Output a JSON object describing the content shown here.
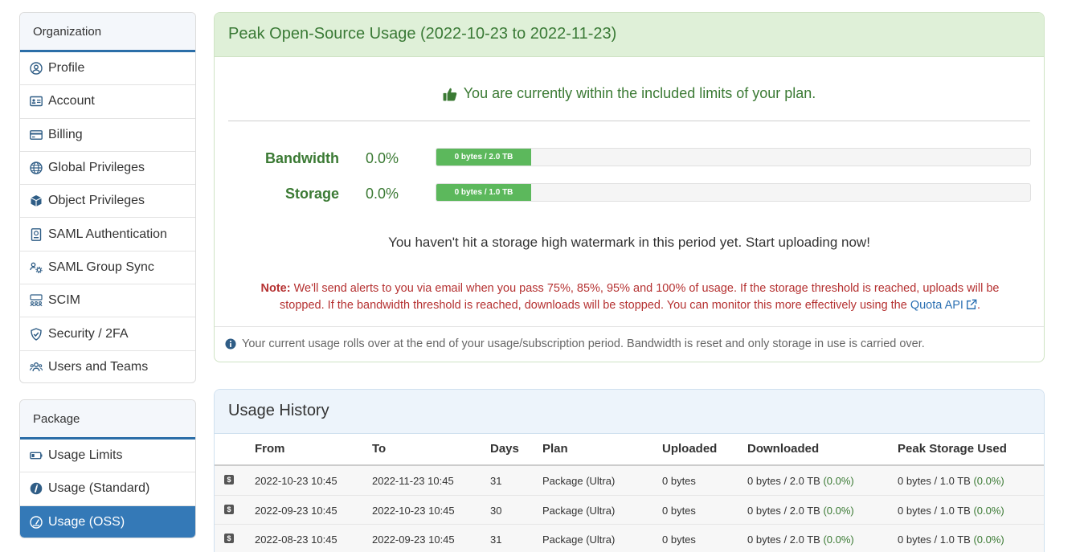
{
  "sidebar": {
    "organization": {
      "title": "Organization",
      "items": [
        {
          "label": "Profile",
          "icon": "user-circle-icon"
        },
        {
          "label": "Account",
          "icon": "id-card-icon"
        },
        {
          "label": "Billing",
          "icon": "credit-card-icon"
        },
        {
          "label": "Global Privileges",
          "icon": "globe-icon"
        },
        {
          "label": "Object Privileges",
          "icon": "cube-icon"
        },
        {
          "label": "SAML Authentication",
          "icon": "passport-icon"
        },
        {
          "label": "SAML Group Sync",
          "icon": "users-cog-icon"
        },
        {
          "label": "SCIM",
          "icon": "network-users-icon"
        },
        {
          "label": "Security / 2FA",
          "icon": "shield-check-icon"
        },
        {
          "label": "Users and Teams",
          "icon": "users-icon"
        }
      ]
    },
    "package": {
      "title": "Package",
      "items": [
        {
          "label": "Usage Limits",
          "icon": "battery-icon",
          "active": false
        },
        {
          "label": "Usage (Standard)",
          "icon": "gauge-info-icon",
          "active": false
        },
        {
          "label": "Usage (OSS)",
          "icon": "gauge-icon",
          "active": true
        }
      ]
    }
  },
  "peak": {
    "title": "Peak Open-Source Usage (2022-10-23 to 2022-11-23)",
    "status": "You are currently within the included limits of your plan.",
    "status_icon": "thumbs-up-icon",
    "meters": [
      {
        "label": "Bandwidth",
        "percent": "0.0%",
        "bar_text": "0 bytes / 2.0 TB"
      },
      {
        "label": "Storage",
        "percent": "0.0%",
        "bar_text": "0 bytes / 1.0 TB"
      }
    ],
    "watermark": "You haven't hit a storage high watermark in this period yet. Start uploading now!",
    "note_label": "Note:",
    "note_text": " We'll send alerts to you via email when you pass 75%, 85%, 95% and 100% of usage. If the storage threshold is reached, uploads will be stopped. If the bandwidth threshold is reached, downloads will be stopped. You can monitor this more effectively using the ",
    "note_link": "Quota API",
    "note_end": ".",
    "footer": "Your current usage rolls over at the end of your usage/subscription period. Bandwidth is reset and only storage in use is carried over."
  },
  "history": {
    "title": "Usage History",
    "columns": [
      "From",
      "To",
      "Days",
      "Plan",
      "Uploaded",
      "Downloaded",
      "Peak Storage Used"
    ],
    "rows": [
      {
        "from": "2022-10-23 10:45",
        "to": "2022-11-23 10:45",
        "days": "31",
        "plan": "Package (Ultra)",
        "uploaded": "0 bytes",
        "downloaded": "0 bytes / 2.0 TB",
        "downloaded_pct": "(0.0%)",
        "storage": "0 bytes / 1.0 TB",
        "storage_pct": "(0.0%)"
      },
      {
        "from": "2022-09-23 10:45",
        "to": "2022-10-23 10:45",
        "days": "30",
        "plan": "Package (Ultra)",
        "uploaded": "0 bytes",
        "downloaded": "0 bytes / 2.0 TB",
        "downloaded_pct": "(0.0%)",
        "storage": "0 bytes / 1.0 TB",
        "storage_pct": "(0.0%)"
      },
      {
        "from": "2022-08-23 10:45",
        "to": "2022-09-23 10:45",
        "days": "31",
        "plan": "Package (Ultra)",
        "uploaded": "0 bytes",
        "downloaded": "0 bytes / 2.0 TB",
        "downloaded_pct": "(0.0%)",
        "storage": "0 bytes / 1.0 TB",
        "storage_pct": "(0.0%)"
      }
    ]
  },
  "colors": {
    "accent": "#3479b7",
    "success": "#3b7a34",
    "bar_fill": "#5cb85c",
    "danger": "#b53131"
  }
}
